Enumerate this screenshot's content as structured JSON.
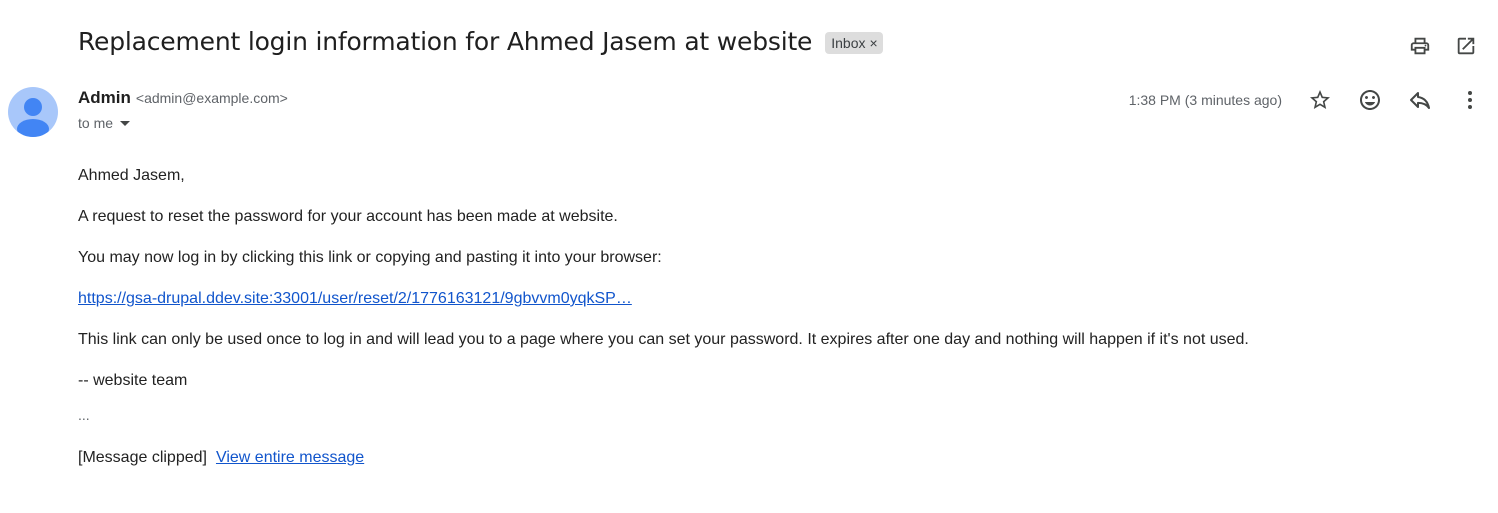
{
  "email": {
    "subject": "Replacement login information for Ahmed Jasem at website",
    "label": "Inbox",
    "label_remove": "×",
    "sender_name": "Admin",
    "sender_email": "<admin@example.com>",
    "recipient": "to me",
    "timestamp": "1:38 PM (3 minutes ago)"
  },
  "body": {
    "greeting": "Ahmed Jasem,",
    "line1": "A request to reset the password for your account has been made at website.",
    "line2": "You may now log in by clicking this link or copying and pasting it into your browser:",
    "link": "https://gsa-drupal.ddev.site:33001/user/reset/2/1776163121/9gbvvm0yqkSP…",
    "line3": "This link can only be used once to log in and will lead you to a page where you can set your password. It expires after one day and nothing will happen if it's not used.",
    "signature": "-- website team",
    "ellipsis": "...",
    "clipped_text": "[Message clipped]",
    "view_entire": "View entire message"
  },
  "icons": {
    "top": [
      "print-icon",
      "open-in-new-window-icon"
    ],
    "actions": [
      "star-icon",
      "emoji-react-icon",
      "reply-icon",
      "more-vert-icon"
    ],
    "avatar": "person-avatar-icon"
  }
}
